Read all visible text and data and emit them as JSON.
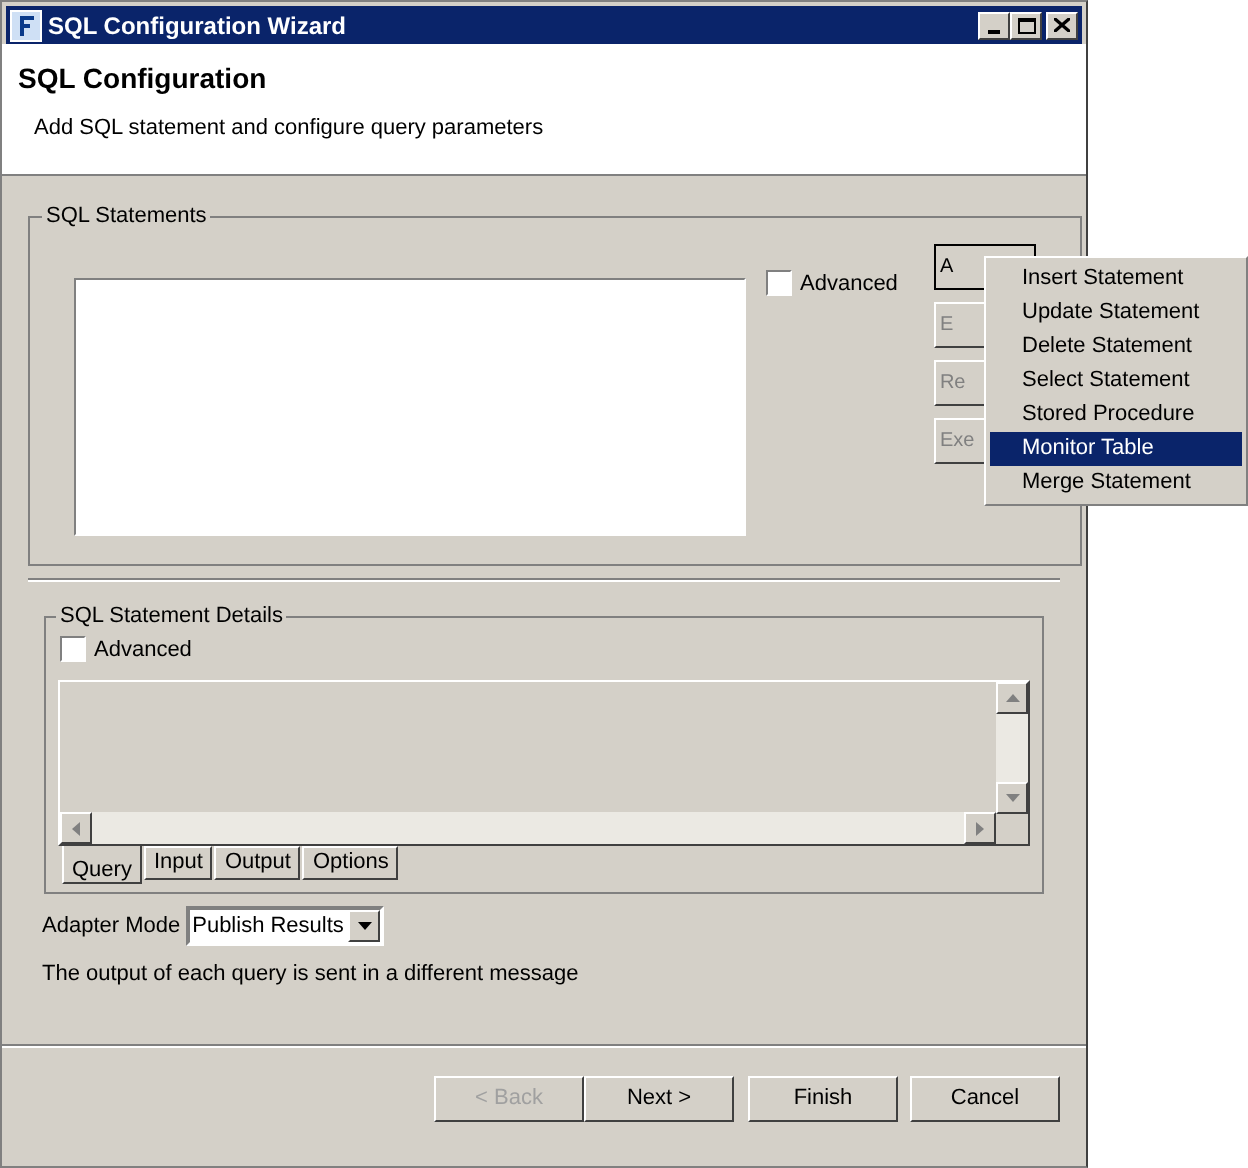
{
  "window": {
    "title": "SQL Configuration Wizard"
  },
  "header": {
    "title": "SQL Configuration",
    "subtitle": "Add SQL statement and configure query parameters"
  },
  "sql_statements": {
    "label": "SQL Statements",
    "advanced": {
      "label": "Advanced",
      "checked": false
    },
    "buttons": [
      {
        "label": "A",
        "disabled": false
      },
      {
        "label": "E",
        "disabled": true
      },
      {
        "label": "Re",
        "disabled": true
      },
      {
        "label": "Exe",
        "disabled": true
      }
    ]
  },
  "add_menu": [
    {
      "label": "Insert Statement",
      "selected": false
    },
    {
      "label": "Update Statement",
      "selected": false
    },
    {
      "label": "Delete Statement",
      "selected": false
    },
    {
      "label": "Select Statement",
      "selected": false
    },
    {
      "label": "Stored Procedure",
      "selected": false
    },
    {
      "label": "Monitor Table",
      "selected": true
    },
    {
      "label": "Merge Statement",
      "selected": false
    }
  ],
  "details": {
    "label": "SQL Statement Details",
    "advanced": {
      "label": "Advanced",
      "checked": false
    },
    "tabs": [
      {
        "label": "Query",
        "selected": true
      },
      {
        "label": "Input",
        "selected": false
      },
      {
        "label": "Output",
        "selected": false
      },
      {
        "label": "Options",
        "selected": false
      }
    ]
  },
  "adapter_mode": {
    "label": "Adapter Mode",
    "value": "Publish Results"
  },
  "help_text": "The output of each query is sent in a different message",
  "footer_buttons": [
    {
      "label": "< Back",
      "disabled": true
    },
    {
      "label": "Next >",
      "disabled": false
    },
    {
      "label": "Finish",
      "disabled": false
    },
    {
      "label": "Cancel",
      "disabled": false
    }
  ]
}
